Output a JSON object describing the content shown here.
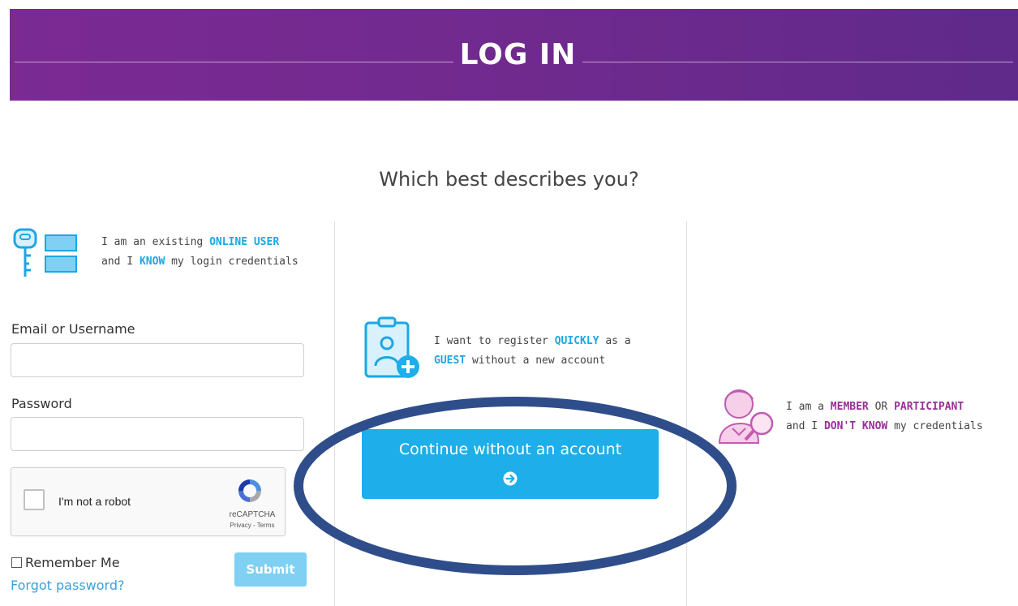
{
  "header": {
    "title": "LOG IN"
  },
  "question": "Which best describes you?",
  "existing_user": {
    "line1_prefix": "I am an existing ",
    "line1_highlight": "ONLINE USER",
    "line2_prefix": "and I ",
    "line2_highlight": "KNOW",
    "line2_suffix": " my login credentials",
    "icon": "key-icon",
    "email_label": "Email or Username",
    "password_label": "Password",
    "email_value": "",
    "password_value": "",
    "captcha_label": "I'm not a robot",
    "captcha_brand": "reCAPTCHA",
    "captcha_links": "Privacy - Terms",
    "remember_label": "Remember Me",
    "forgot_label": "Forgot password?",
    "submit_label": "Submit"
  },
  "guest": {
    "line1_prefix": "I want to register ",
    "line1_highlight": "QUICKLY",
    "line1_suffix": " as a",
    "line2_highlight": "GUEST",
    "line2_suffix": " without a new account",
    "icon": "clipboard-add-user-icon",
    "button_label": "Continue without an account",
    "button_icon": "arrow-right-circle-icon"
  },
  "member": {
    "line1_prefix": "I am a ",
    "line1_highlight1": "MEMBER",
    "line1_mid": " OR ",
    "line1_highlight2": "PARTICIPANT",
    "line2_prefix": "and I ",
    "line2_highlight": "DON'T KNOW",
    "line2_suffix": " my credentials",
    "icon": "user-search-icon"
  },
  "colors": {
    "banner": "#7b2a93",
    "accent_blue": "#1eaee9",
    "accent_purple": "#9a2f98",
    "annotation_ellipse": "#2f4d8a"
  }
}
